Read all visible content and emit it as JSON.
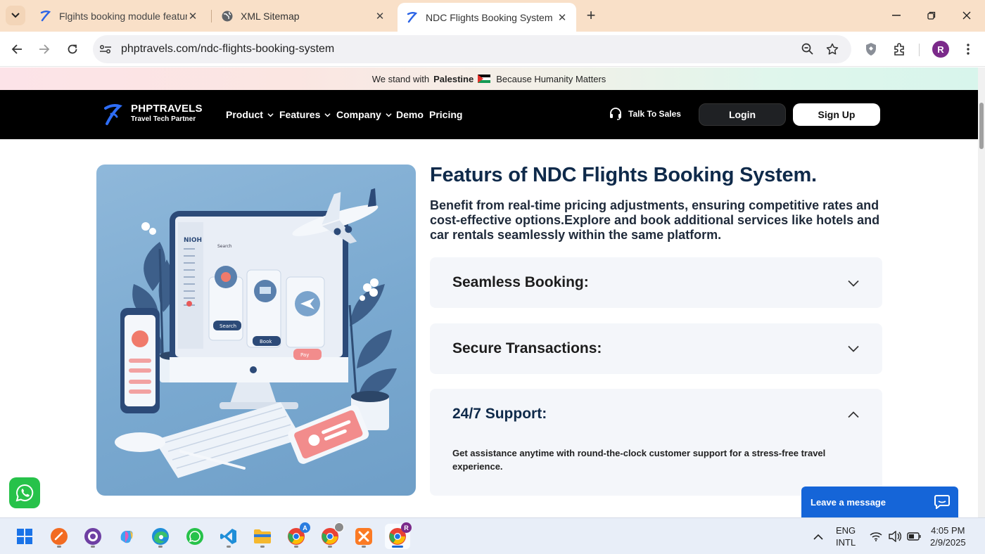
{
  "browser": {
    "tabs": [
      {
        "title": "Flgihts booking module feature",
        "active": false
      },
      {
        "title": "XML Sitemap",
        "active": false
      },
      {
        "title": "NDC Flights Booking System",
        "active": true
      }
    ],
    "url": "phptravels.com/ndc-flights-booking-system",
    "profile_initial": "R"
  },
  "banner": {
    "prefix": "We stand with",
    "country": "Palestine",
    "suffix": "Because Humanity Matters"
  },
  "navbar": {
    "brand_name": "PHPTRAVELS",
    "brand_tagline": "Travel Tech Partner",
    "menu": [
      {
        "label": "Product",
        "has_dropdown": true
      },
      {
        "label": "Features",
        "has_dropdown": true
      },
      {
        "label": "Company",
        "has_dropdown": true
      },
      {
        "label": "Demo",
        "has_dropdown": false
      },
      {
        "label": "Pricing",
        "has_dropdown": false
      }
    ],
    "talk_to_sales": "Talk To Sales",
    "login": "Login",
    "signup": "Sign Up"
  },
  "hero": {
    "headline": "Featurs of NDC Flights Booking System.",
    "subtext": "Benefit from real-time pricing adjustments, ensuring competitive rates and cost-effective options.Explore and book additional services like hotels and car rentals seamlessly within the same platform.",
    "illustration_labels": {
      "screen_logo": "NIOH",
      "search": "Search",
      "book": "Book",
      "pay": "Pay"
    }
  },
  "accordion": [
    {
      "title": "Seamless Booking:",
      "expanded": false
    },
    {
      "title": "Secure Transactions:",
      "expanded": false
    },
    {
      "title": "24/7 Support:",
      "expanded": true,
      "body": "Get assistance anytime with round-the-clock customer support for a stress-free travel experience."
    }
  ],
  "chat": {
    "leave_message": "Leave a message"
  },
  "taskbar": {
    "apps": [
      "windows-start",
      "vlc",
      "github-desktop",
      "copilot",
      "edge",
      "whatsapp",
      "vscode",
      "file-explorer",
      "chrome-a",
      "chrome-2",
      "xampp",
      "chrome-r"
    ],
    "chrome_a_badge": "A",
    "chrome_r_badge": "R",
    "language_line1": "ENG",
    "language_line2": "INTL",
    "time": "4:05 PM",
    "date": "2/9/2025"
  },
  "colors": {
    "navbar_bg": "#000000",
    "headline": "#0f2a4a",
    "accordion_bg": "#f4f6fa",
    "whatsapp": "#27c24a",
    "chat_blue": "#1565d8"
  }
}
